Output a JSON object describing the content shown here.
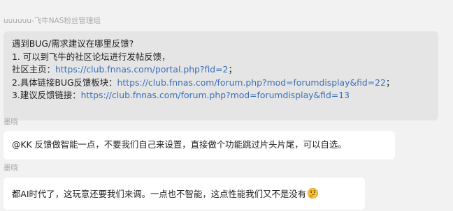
{
  "messages": [
    {
      "sender": "uuuuuu-飞牛NAS粉丝管理组",
      "lines": {
        "line1": "遇到BUG/需求建议在哪里反馈?",
        "line2": "1. 可以到飞牛的社区论坛进行发帖反馈，",
        "line3_label": "社区主页：",
        "line3_link": "https://club.fnnas.com/portal.php?fid=2",
        "line3_suffix": "；",
        "line4_label": "2.具体链接BUG反馈板块：",
        "line4_link": "https://club.fnnas.com/forum.php?mod=forumdisplay&fid=22",
        "line4_suffix": "；",
        "line5_label": "3.建议反馈链接：",
        "line5_link": "https://club.fnnas.com/forum.php?mod=forumdisplay&fid=13"
      }
    },
    {
      "sender": "墨晓",
      "text": "@KK 反馈做智能一点，不要我们自己来设置，直接做个功能跳过片头片尾，可以自选。"
    },
    {
      "sender": "墨晓",
      "text": "都AI时代了，这玩意还要我们来调。一点也不智能，这点性能我们又不是没有",
      "emoji": "thinking-face-icon"
    }
  ],
  "colors": {
    "background": "#f2f2f2",
    "bubble": "#ffffff",
    "highlighted_bubble": "#e5e5e5",
    "link": "#3b6fb6",
    "sender": "#a9a9a9"
  }
}
